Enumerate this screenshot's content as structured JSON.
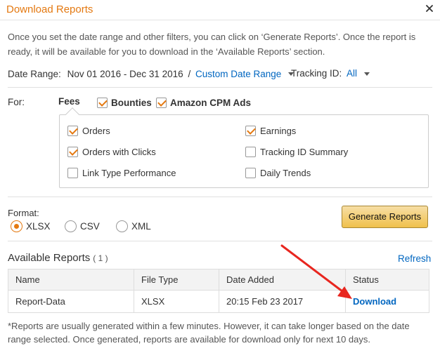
{
  "header": {
    "title": "Download Reports",
    "close_icon": "close-icon"
  },
  "intro": "Once you set the date range and other filters, you can click on ‘Generate Reports’. Once the report is ready, it will be available for you to download in the ‘Available Reports’ section.",
  "date_range": {
    "label": "Date Range:",
    "value": "Nov 01 2016 - Dec 31 2016",
    "separator": "/",
    "custom_link": "Custom Date Range"
  },
  "tracking": {
    "label": "Tracking ID:",
    "value": "All"
  },
  "filters": {
    "for_label": "For:",
    "tabs": [
      {
        "label": "Fees",
        "checkbox": false
      },
      {
        "label": "Bounties",
        "checked": true
      },
      {
        "label": "Amazon CPM Ads",
        "checked": true
      }
    ],
    "options": [
      {
        "label": "Orders",
        "checked": true
      },
      {
        "label": "Earnings",
        "checked": true
      },
      {
        "label": "Orders with Clicks",
        "checked": true
      },
      {
        "label": "Tracking ID Summary",
        "checked": false
      },
      {
        "label": "Link Type Performance",
        "checked": false
      },
      {
        "label": "Daily Trends",
        "checked": false
      }
    ]
  },
  "format": {
    "label": "Format:",
    "options": [
      {
        "label": "XLSX",
        "selected": true
      },
      {
        "label": "CSV",
        "selected": false
      },
      {
        "label": "XML",
        "selected": false
      }
    ],
    "generate_button": "Generate Reports"
  },
  "available": {
    "title": "Available Reports",
    "count": "( 1 )",
    "refresh": "Refresh",
    "columns": [
      "Name",
      "File Type",
      "Date Added",
      "Status"
    ],
    "rows": [
      {
        "name": "Report-Data",
        "file_type": "XLSX",
        "date_added": "20:15 Feb 23 2017",
        "status": "Download"
      }
    ]
  },
  "footnote": "*Reports are usually generated within a few minutes. However, it can take longer based on the date range selected. Once generated, reports are available for download only for next 10 days.",
  "colors": {
    "accent": "#e47911",
    "link": "#0066c0",
    "annotation_arrow": "#e8261f",
    "button_bg": "#f0c14b"
  }
}
